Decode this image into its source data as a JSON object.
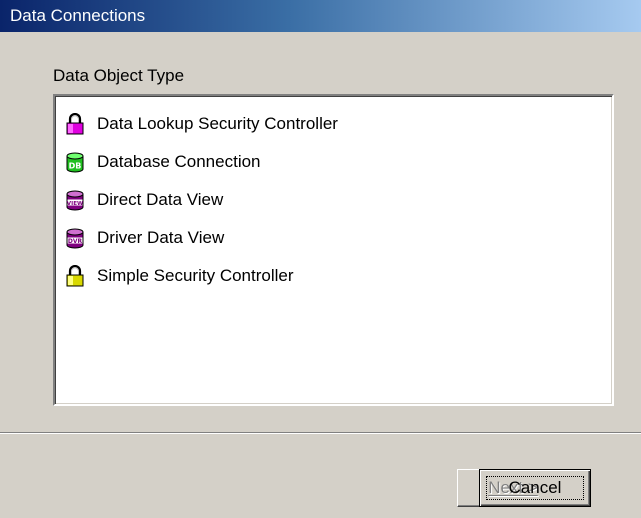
{
  "window": {
    "title": "Data Connections"
  },
  "group": {
    "label": "Data Object Type"
  },
  "list": {
    "items": [
      {
        "label": "Data Lookup Security Controller",
        "icon": "magenta-lock-icon"
      },
      {
        "label": "Database Connection",
        "icon": "green-database-icon"
      },
      {
        "label": "Direct Data View",
        "icon": "purple-view-icon"
      },
      {
        "label": "Driver Data View",
        "icon": "purple-dvr-icon"
      },
      {
        "label": "Simple Security Controller",
        "icon": "yellow-lock-icon"
      }
    ]
  },
  "buttons": {
    "next": "Next >",
    "cancel": "Cancel",
    "next_enabled": false
  },
  "colors": {
    "titlebar_start": "#0a246a",
    "titlebar_end": "#a6caf0",
    "face": "#d4d0c8",
    "disabled_text": "#808080"
  }
}
